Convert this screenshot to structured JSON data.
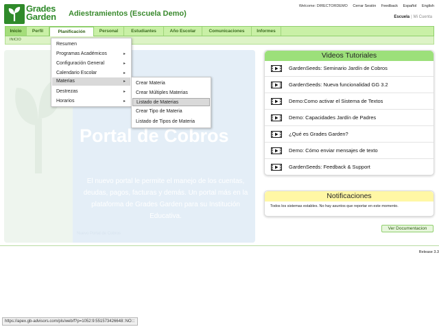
{
  "header": {
    "logo_line1": "Grades",
    "logo_line2": "Garden",
    "app_title": "Adiestramientos (Escuela Demo)",
    "welcome": "Welcome: DIRECTORDEMO",
    "links": [
      "Cerrar Sesión",
      "Feedback",
      "Español",
      "English"
    ],
    "scope_active": "Escuela",
    "scope_other": "Mi Cuenta"
  },
  "nav": {
    "tabs": [
      "Inicio",
      "Perfil",
      "Planificación",
      "Personal",
      "Estudiantes",
      "Año Escolar",
      "Comunicaciones",
      "Informes"
    ],
    "breadcrumb": "INICIO"
  },
  "menu": {
    "items": [
      "Resumen",
      "Programas Académicos",
      "Configuración General",
      "Calendario Escolar",
      "Materias",
      "Destrezas",
      "Horarios"
    ]
  },
  "submenu": {
    "items": [
      "Crear Materia",
      "Crear Múltiples Materias",
      "Listado de Materias",
      "Crear Tipo de Materia",
      "Listado de Tipos de Materia"
    ]
  },
  "banner": {
    "title": "Portal de Cobros",
    "text": "El nuevo portal le permite el manejo de los cuentas, deudas, pagos, facturas y demás. Un portal más en la plataforma de Grades Garden para su Institución Educativa.",
    "tag": "Nuevo Portal de Cobros"
  },
  "videos": {
    "title": "Videos Tutoriales",
    "items": [
      "GardenSeeds: Seminario Jardín de Cobros",
      "GardenSeeds: Nueva funcionalidad GG 3.2",
      "Demo:Como activar el Sistema de Textos",
      "Demo: Capacidades Jardín de Padres",
      "¿Qué es Grades Garden?",
      "Demo: Cómo enviar mensajes de texto",
      "GardenSeeds: Feedback & Support"
    ]
  },
  "notifications": {
    "title": "Notificaciones",
    "text": "Todos los sistemas estables. No hay asuntos que reportar en este momento."
  },
  "doc_button": "Ver Documentacion",
  "release": "Release 3.3",
  "status_url": "https://apex.gb-advisors.com/pls/web/f?p=1052:9:551573426648::NO:::",
  "colors": {
    "brand_green": "#2f8a2a",
    "nav_bg": "#c9f0a6",
    "videos_header": "#9ce07a",
    "notif_header": "#fff7a5"
  },
  "icons": {
    "video": "video-play-icon",
    "submenu_arrow": "chevron-right-icon",
    "logo": "sprout-icon"
  }
}
